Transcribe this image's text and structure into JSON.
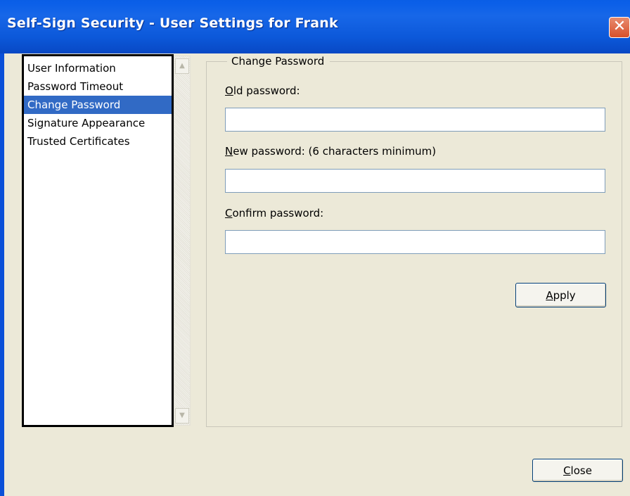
{
  "window": {
    "title": "Self-Sign Security - User Settings for Frank",
    "close_glyph": "✕"
  },
  "sidebar": {
    "items": [
      {
        "label": "User Information",
        "selected": false
      },
      {
        "label": "Password Timeout",
        "selected": false
      },
      {
        "label": "Change Password",
        "selected": true
      },
      {
        "label": "Signature Appearance",
        "selected": false
      },
      {
        "label": "Trusted Certificates",
        "selected": false
      }
    ],
    "scroll_up_icon": "▲",
    "scroll_down_icon": "▼"
  },
  "change_password": {
    "group_label": "Change Password",
    "old_password": {
      "mnemonic": "O",
      "rest": "ld password:",
      "value": ""
    },
    "new_password": {
      "mnemonic": "N",
      "rest": "ew password: (6 characters minimum)",
      "value": ""
    },
    "confirm_password": {
      "mnemonic": "C",
      "rest": "onfirm password:",
      "value": ""
    },
    "apply_button": {
      "mnemonic": "A",
      "rest": "pply"
    }
  },
  "footer": {
    "close_button": {
      "mnemonic": "C",
      "rest": "lose"
    }
  }
}
